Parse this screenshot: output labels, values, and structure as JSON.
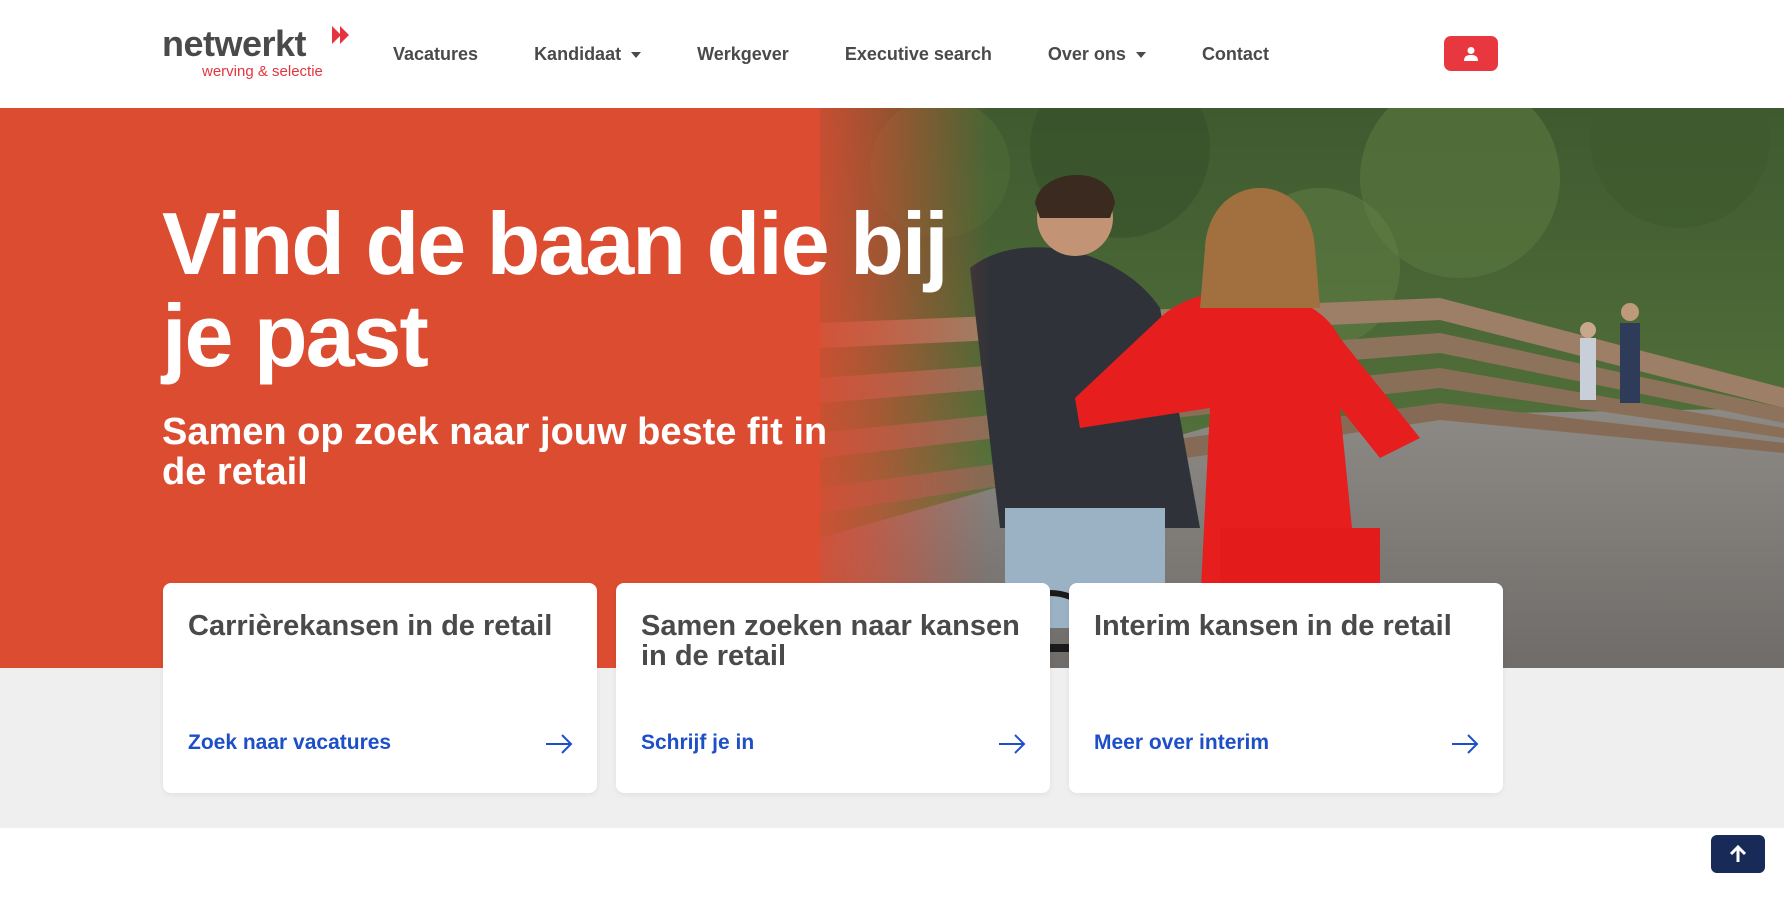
{
  "header": {
    "logo": {
      "name": "netwerkt",
      "tagline": "werving & selectie"
    },
    "nav": [
      {
        "label": "Vacatures",
        "dropdown": false
      },
      {
        "label": "Kandidaat",
        "dropdown": true
      },
      {
        "label": "Werkgever",
        "dropdown": false
      },
      {
        "label": "Executive search",
        "dropdown": false
      },
      {
        "label": "Over ons",
        "dropdown": true
      },
      {
        "label": "Contact",
        "dropdown": false
      }
    ],
    "account_icon": "user-icon"
  },
  "hero": {
    "title": "Vind de baan die bij je past",
    "subtitle": "Samen op zoek naar jouw beste fit in de retail"
  },
  "cards": [
    {
      "title": "Carrièrekansen in de retail",
      "link": "Zoek naar vacatures"
    },
    {
      "title": "Samen zoeken naar kansen in de retail",
      "link": "Schrijf je in"
    },
    {
      "title": "Interim kansen in de retail",
      "link": "Meer over interim"
    }
  ],
  "colors": {
    "brand_red": "#e8373f",
    "hero_orange": "#dc4c31",
    "link_blue": "#1d4fc9",
    "scroll_button": "#182a58"
  }
}
